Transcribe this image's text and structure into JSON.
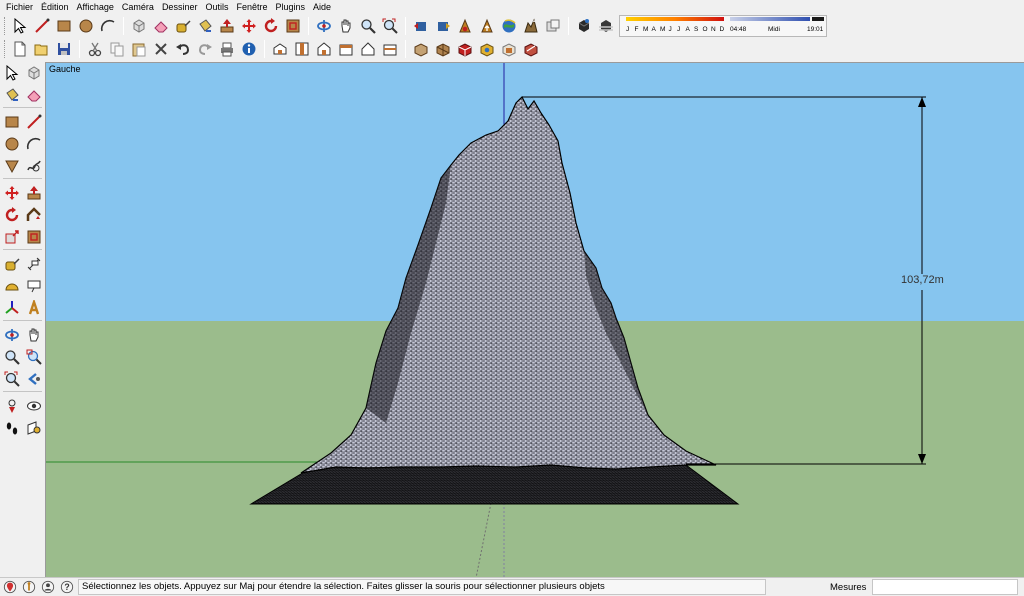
{
  "menu": [
    "Fichier",
    "Édition",
    "Affichage",
    "Caméra",
    "Dessiner",
    "Outils",
    "Fenêtre",
    "Plugins",
    "Aide"
  ],
  "toolbar1": {
    "groups": [
      [
        "select-icon",
        "line-icon",
        "rectangle-icon",
        "circle-icon",
        "arc-icon"
      ],
      [
        "make-component-icon",
        "eraser-icon",
        "tape-measure-icon",
        "paint-bucket-icon",
        "push-pull-icon",
        "move-icon",
        "rotate-icon",
        "offset-icon"
      ],
      [
        "orbit-icon",
        "pan-icon",
        "zoom-icon",
        "zoom-extents-icon"
      ],
      [
        "previous-view-icon",
        "next-view-icon",
        "get-models-icon",
        "share-model-icon",
        "google-earth-icon",
        "photo-textures-icon",
        "share-component-icon"
      ],
      [
        "shadows-toggle-icon",
        "fog-icon"
      ]
    ]
  },
  "shadow_settings": {
    "months": [
      "J",
      "F",
      "M",
      "A",
      "M",
      "J",
      "J",
      "A",
      "S",
      "O",
      "N",
      "D"
    ],
    "time_start": "04:48",
    "time_mid": "Midi",
    "time_end": "19:01"
  },
  "toolbar2": {
    "groups": [
      [
        "new-icon",
        "open-icon",
        "save-icon"
      ],
      [
        "cut-icon",
        "copy-icon",
        "paste-icon",
        "delete-icon",
        "undo-icon",
        "redo-icon",
        "print-icon",
        "model-info-icon"
      ],
      [
        "iso-view-icon",
        "top-view-icon",
        "front-view-icon",
        "right-view-icon",
        "back-view-icon",
        "left-view-icon"
      ],
      [
        "xray-icon",
        "wireframe-icon",
        "hidden-line-icon",
        "shaded-icon",
        "shaded-texture-icon",
        "monochrome-icon"
      ]
    ]
  },
  "left_toolbar": {
    "groups": [
      [
        [
          "select-icon",
          "make-component-icon"
        ],
        [
          "paint-bucket-icon",
          "eraser-icon"
        ]
      ],
      [
        [
          "rectangle-icon",
          "line-icon"
        ],
        [
          "circle-icon",
          "arc-icon"
        ],
        [
          "polygon-icon",
          "freehand-icon"
        ]
      ],
      [
        [
          "move-icon",
          "push-pull-icon"
        ],
        [
          "rotate-icon",
          "follow-me-icon"
        ],
        [
          "scale-icon",
          "offset-icon"
        ]
      ],
      [
        [
          "tape-measure-icon",
          "dimension-icon"
        ],
        [
          "protractor-icon",
          "text-icon"
        ],
        [
          "axes-icon",
          "3d-text-icon"
        ]
      ],
      [
        [
          "orbit-icon",
          "pan-icon"
        ],
        [
          "zoom-icon",
          "zoom-window-icon"
        ],
        [
          "zoom-extents-icon",
          "previous-icon"
        ]
      ],
      [
        [
          "position-camera-icon",
          "look-around-icon"
        ],
        [
          "walk-icon",
          "section-plane-icon"
        ]
      ]
    ]
  },
  "viewport": {
    "view_name": "Gauche",
    "dimension": "103,72m",
    "sky_color": "#86c5ef",
    "ground_color": "#9bbc8c"
  },
  "statusbar": {
    "text": "Sélectionnez les objets. Appuyez sur Maj pour étendre la sélection. Faites glisser la souris pour sélectionner plusieurs objets",
    "measures_label": "Mesures",
    "icons": [
      "geo-location-icon",
      "credits-icon",
      "user-icon",
      "help-icon"
    ]
  }
}
